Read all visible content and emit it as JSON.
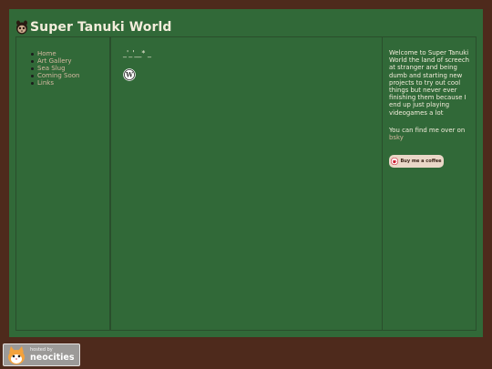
{
  "header": {
    "title": "Super Tanuki World",
    "logo_icon": "tanuki-icon"
  },
  "nav": {
    "items": [
      {
        "label": "Home"
      },
      {
        "label": "Art Gallery"
      },
      {
        "label": "Sea Slug"
      },
      {
        "label": "Coming Soon"
      },
      {
        "label": "Links"
      }
    ]
  },
  "main": {
    "kaomoji": "_'_'__* _",
    "widget_icon": "wordpress-icon"
  },
  "sidebar": {
    "welcome": "Welcome to Super Tanuki World the land of screech at stranger and being dumb and starting new projects to try out cool things but never ever finishing them because I end up just playing videogames a lot",
    "find_me": "You can find me over on",
    "bsky_link": "bsky",
    "coffee_label": "Buy me a coffee",
    "coffee_icon": "coffee-cup-icon"
  },
  "footer": {
    "hosted_by": "hosted by",
    "host_name": "neocities",
    "badge_icon": "neocities-cat-icon"
  },
  "colors": {
    "background": "#4e2a1c",
    "panel": "#316938",
    "link": "#d7b9a2",
    "text": "#f3eddb"
  }
}
